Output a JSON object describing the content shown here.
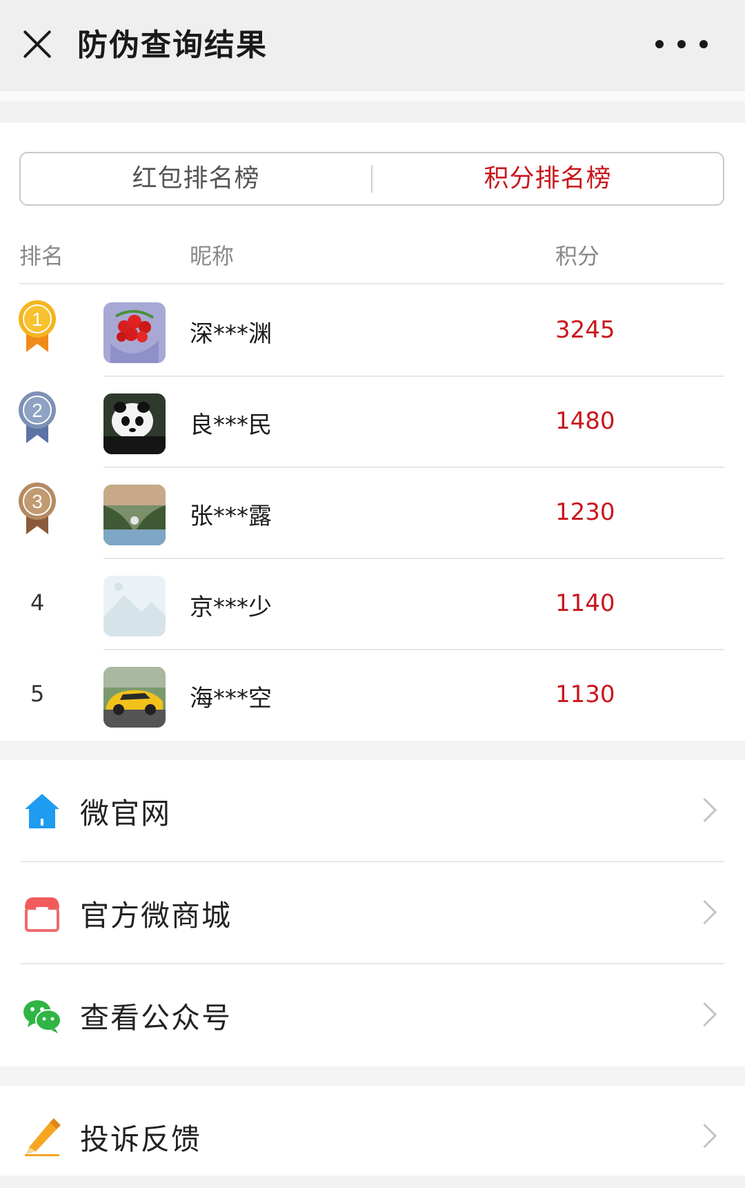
{
  "header": {
    "title": "防伪查询结果"
  },
  "tabs": [
    {
      "label": "红包排名榜",
      "active": false
    },
    {
      "label": "积分排名榜",
      "active": true
    }
  ],
  "table": {
    "columns": {
      "rank": "排名",
      "nickname": "昵称",
      "score": "积分"
    },
    "rows": [
      {
        "rank": "1",
        "nickname": "深***渊",
        "score": "3245",
        "medal": "gold"
      },
      {
        "rank": "2",
        "nickname": "良***民",
        "score": "1480",
        "medal": "silver"
      },
      {
        "rank": "3",
        "nickname": "张***露",
        "score": "1230",
        "medal": "bronze"
      },
      {
        "rank": "4",
        "nickname": "京***少",
        "score": "1140"
      },
      {
        "rank": "5",
        "nickname": "海***空",
        "score": "1130"
      }
    ]
  },
  "menu": [
    {
      "label": "微官网",
      "icon": "home-icon"
    },
    {
      "label": "官方微商城",
      "icon": "shop-icon"
    },
    {
      "label": "查看公众号",
      "icon": "wechat-icon"
    },
    {
      "label": "投诉反馈",
      "icon": "pencil-icon"
    }
  ],
  "colors": {
    "accent": "#c8161d",
    "background": "#f2f2f2"
  }
}
